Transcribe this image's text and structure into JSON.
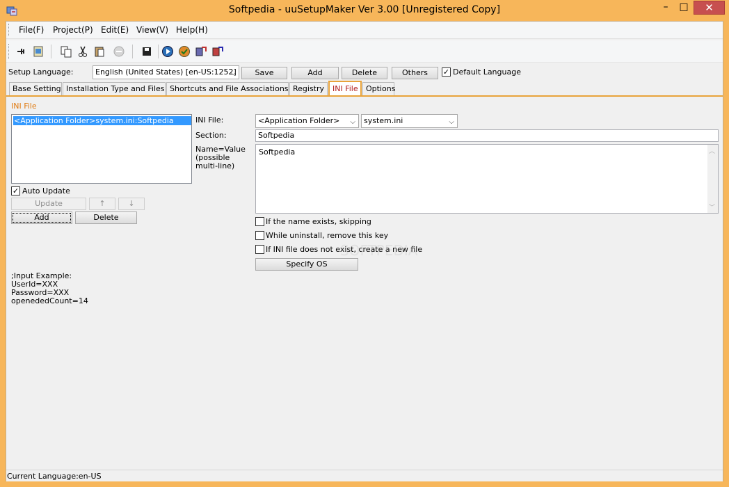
{
  "window": {
    "title": "Softpedia - uuSetupMaker Ver 3.00 [Unregistered Copy]",
    "minimize_glyph": "–",
    "maximize_glyph": "□",
    "close_glyph": "✕"
  },
  "menu": {
    "items": [
      {
        "label": "File(F)"
      },
      {
        "label": "Project(P)"
      },
      {
        "label": "Edit(E)"
      },
      {
        "label": "View(V)"
      },
      {
        "label": "Help(H)"
      }
    ]
  },
  "toolbar": {
    "icons": [
      "pin-icon",
      "image-icon",
      "copy-icon",
      "cut-icon",
      "paste-icon",
      "disabled-action-icon",
      "save-icon",
      "run-icon",
      "check-icon",
      "build-icon",
      "build-alt-icon"
    ]
  },
  "language_bar": {
    "label": "Setup Language:",
    "selected": "English (United States) [en-US:1252]",
    "save": "Save",
    "add": "Add",
    "delete": "Delete",
    "others": "Others",
    "default_language_label": "Default Language",
    "default_language_checked": true
  },
  "tabs": [
    {
      "label": "Base Setting"
    },
    {
      "label": "Installation Type and Files"
    },
    {
      "label": "Shortcuts and File Associations"
    },
    {
      "label": "Registry"
    },
    {
      "label": "INI File",
      "active": true
    },
    {
      "label": "Options"
    }
  ],
  "ini_panel": {
    "section_title": "INI File",
    "list_items": [
      "<Application Folder>system.ini:Softpedia"
    ],
    "auto_update_label": "Auto Update",
    "auto_update_checked": true,
    "update_button": "Update",
    "up_button": "↑",
    "down_button": "↓",
    "add_button": "Add",
    "delete_button": "Delete",
    "ini_file_label": "INI File:",
    "folder_selected": "<Application Folder>",
    "file_selected": "system.ini",
    "section_label": "Section:",
    "section_value": "Softpedia",
    "name_value_label": "Name=Value\n(possible\nmulti-line)",
    "name_value_text": "Softpedia",
    "option_skip_label": "If the name exists, skipping",
    "option_remove_label": "While uninstall, remove this key",
    "option_create_label": "If INI file does not exist, create a new file",
    "specify_os_button": "Specify OS",
    "example_text": ";Input Example:\nUserId=XXX\nPassword=XXX\nopenededCount=14"
  },
  "status": {
    "text": "Current Language:en-US"
  },
  "watermark": {
    "text": "SOFTPEDIA"
  }
}
